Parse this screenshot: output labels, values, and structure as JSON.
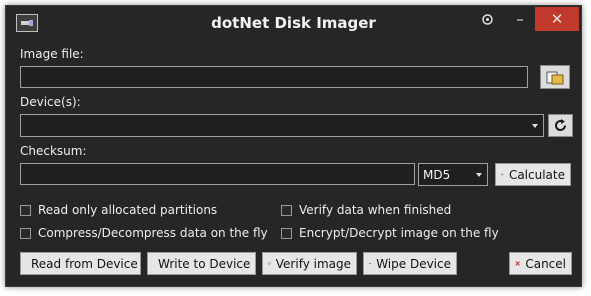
{
  "window": {
    "title": "dotNet Disk Imager",
    "titlebar_buttons": {
      "settings_icon": "gear-icon",
      "minimize_label": "–",
      "close_label": "✕"
    }
  },
  "image_file": {
    "label": "Image file:",
    "value": "",
    "browse_icon": "folder-icon"
  },
  "devices": {
    "label": "Device(s):",
    "value": "",
    "refresh_icon": "refresh-icon"
  },
  "checksum": {
    "label": "Checksum:",
    "value": "",
    "algorithm": "MD5",
    "calculate_label": "Calculate"
  },
  "options": {
    "read_only_allocated": "Read only allocated partitions",
    "verify_when_finished": "Verify data when finished",
    "compress_decompress": "Compress/Decompress data on the fly",
    "encrypt_decrypt": "Encrypt/Decrypt image on the fly"
  },
  "actions": {
    "read": "Read from Device",
    "write": "Write to Device",
    "verify": "Verify image",
    "wipe": "Wipe Device",
    "cancel": "Cancel"
  },
  "colors": {
    "window_bg": "#262626",
    "close_red": "#c0392b",
    "field_bg": "#202020"
  }
}
